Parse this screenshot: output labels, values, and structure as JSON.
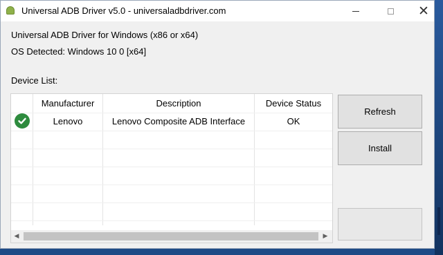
{
  "window": {
    "title": "Universal ADB Driver v5.0 - universaladbdriver.com"
  },
  "info": {
    "line1": "Universal ADB Driver for Windows (x86 or x64)",
    "line2": "OS Detected: Windows 10 0 [x64]"
  },
  "device_list": {
    "label": "Device List:",
    "columns": [
      "Manufacturer",
      "Description",
      "Device Status"
    ],
    "rows": [
      {
        "status_icon": "check-circle-icon",
        "manufacturer": "Lenovo",
        "description": "Lenovo Composite ADB Interface",
        "status": "OK"
      }
    ]
  },
  "buttons": {
    "refresh": "Refresh",
    "install": "Install",
    "empty": ""
  },
  "colors": {
    "ok_green": "#2e8b3e",
    "desktop_blue": "#1e4a86"
  }
}
